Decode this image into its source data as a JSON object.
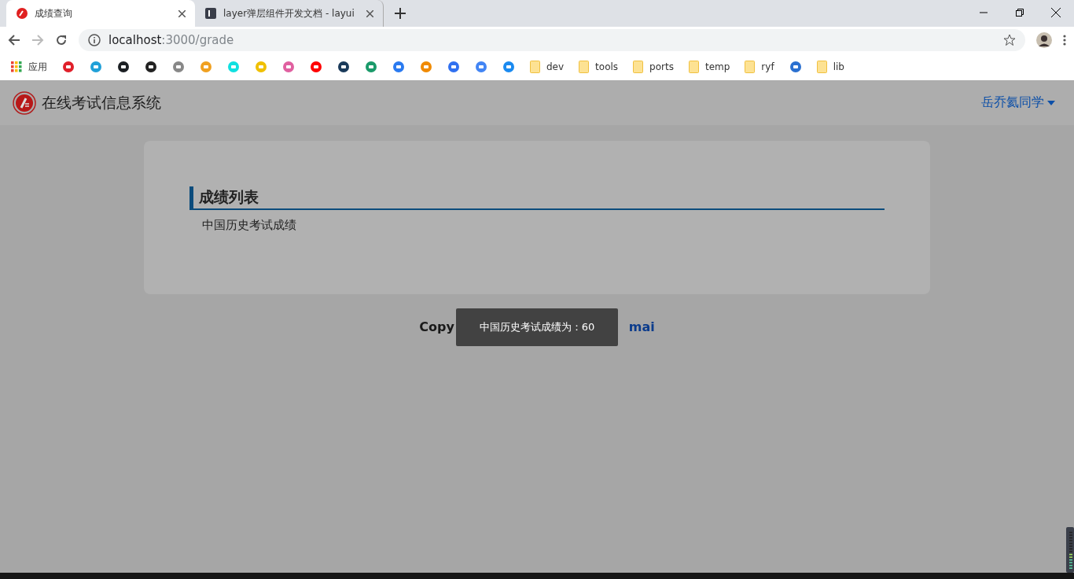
{
  "browser": {
    "tabs": [
      {
        "title": "成绩查询",
        "selected": true,
        "kind": "app"
      },
      {
        "title": "layer弹层组件开发文档 - layui",
        "selected": false,
        "kind": "layui"
      }
    ],
    "address": {
      "host": "localhost",
      "path": ":3000/grade"
    },
    "bookmarks": [
      {
        "kind": "apps",
        "label": "应用"
      },
      {
        "kind": "site",
        "color": "#e0202a"
      },
      {
        "kind": "site",
        "color": "#20a0d8"
      },
      {
        "kind": "site",
        "color": "#1b1f23"
      },
      {
        "kind": "site",
        "color": "#222222"
      },
      {
        "kind": "site",
        "color": "#888888"
      },
      {
        "kind": "site",
        "color": "#f0a020"
      },
      {
        "kind": "site",
        "color": "#10e0e0"
      },
      {
        "kind": "site",
        "color": "#f0c000"
      },
      {
        "kind": "site",
        "color": "#e060a0"
      },
      {
        "kind": "site",
        "color": "#ff0000"
      },
      {
        "kind": "site",
        "color": "#1a3a5a"
      },
      {
        "kind": "site",
        "color": "#1a9a6a"
      },
      {
        "kind": "site",
        "color": "#2a7af0"
      },
      {
        "kind": "site",
        "color": "#f08a00"
      },
      {
        "kind": "site",
        "color": "#3070f0"
      },
      {
        "kind": "site",
        "color": "#4285f4"
      },
      {
        "kind": "site",
        "color": "#1a8af0"
      },
      {
        "kind": "folder",
        "label": "dev"
      },
      {
        "kind": "folder",
        "label": "tools"
      },
      {
        "kind": "folder",
        "label": "ports"
      },
      {
        "kind": "folder",
        "label": "temp"
      },
      {
        "kind": "folder",
        "label": "ryf"
      },
      {
        "kind": "site",
        "color": "#2a70d0"
      },
      {
        "kind": "folder",
        "label": "lib"
      }
    ]
  },
  "navbar": {
    "brand": "在线考试信息系统",
    "user": "岳乔氦同学"
  },
  "card": {
    "heading": "成绩列表",
    "items": [
      "中国历史考试成绩"
    ]
  },
  "footer": {
    "left": "Copy",
    "right": "mai"
  },
  "toast": {
    "text": "中国历史考试成绩为：60"
  }
}
